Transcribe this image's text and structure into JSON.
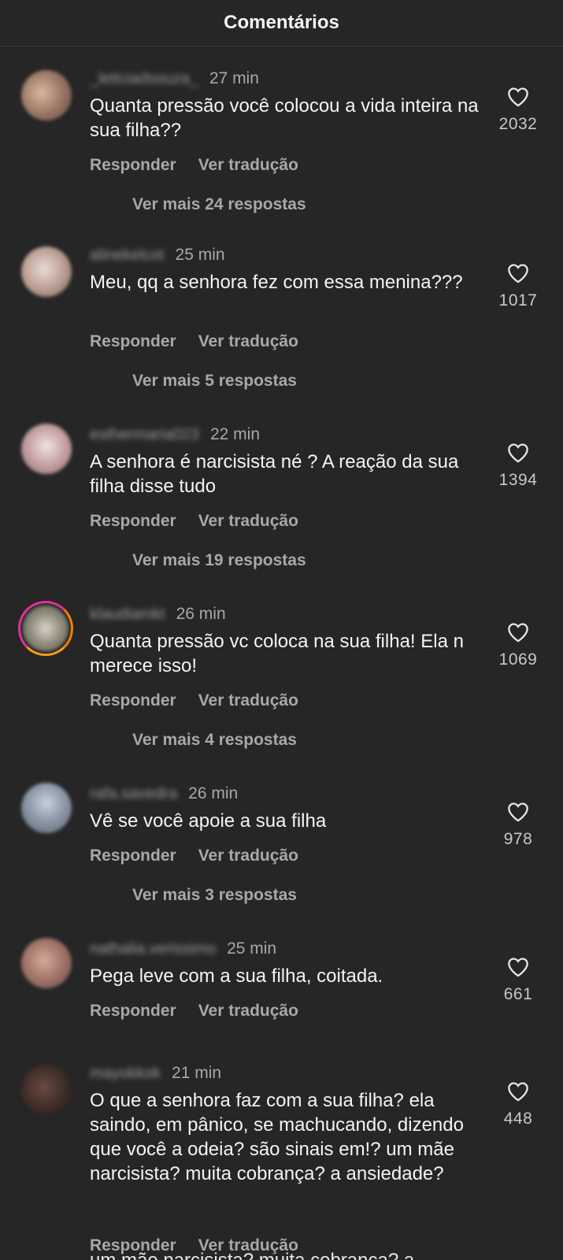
{
  "header": {
    "title": "Comentários"
  },
  "comments": [
    {
      "username": "_leticiadsouza_",
      "time": "27 min",
      "text": "Quanta pressão você colocou a vida inteira na sua filha??",
      "reply": "Responder",
      "translate": "Ver tradução",
      "more": "Ver mais 24 respostas",
      "likes": "2032"
    },
    {
      "username": "alinekelcot",
      "time": "25 min",
      "text": "Meu, qq a senhora fez com essa menina???",
      "reply": "Responder",
      "translate": "Ver tradução",
      "more": "Ver mais 5 respostas",
      "likes": "1017"
    },
    {
      "username": "esthermaria023",
      "time": "22 min",
      "text": "A senhora é narcisista né ? A reação da sua filha disse tudo",
      "reply": "Responder",
      "translate": "Ver tradução",
      "more": "Ver mais 19 respostas",
      "likes": "1394"
    },
    {
      "username": "klaudiamkt",
      "time": "26 min",
      "text": "Quanta pressão vc coloca na sua filha! Ela n merece isso!",
      "reply": "Responder",
      "translate": "Ver tradução",
      "more": "Ver mais 4 respostas",
      "likes": "1069"
    },
    {
      "username": "rafa.savedra",
      "time": "26 min",
      "text": "Vê se você apoie a sua filha",
      "reply": "Responder",
      "translate": "Ver tradução",
      "more": "Ver mais 3 respostas",
      "likes": "978"
    },
    {
      "username": "nathalia.verissimo",
      "time": "25 min",
      "text": "Pega leve com a sua filha, coitada.",
      "reply": "Responder",
      "translate": "Ver tradução",
      "likes": "661"
    },
    {
      "username": "mayokkok",
      "time": "21 min",
      "text": "O que a senhora faz com a sua filha? ela saindo, em pânico, se machucando, dizendo que você a odeia? são sinais em!? um mãe narcisista? muita cobrança? a ansiedade?",
      "reply": "Responder",
      "translate": "Ver tradução",
      "likes": "448"
    }
  ],
  "partial_text": "um mãe narcisista? muita cobrança? a",
  "icons": {
    "like": "heart-outline-icon"
  },
  "colors": {
    "background": "#262626",
    "text": "#f4f4f4",
    "muted": "#a8a8a8",
    "story_ring": [
      "#d300c5",
      "#ff7a00"
    ]
  }
}
